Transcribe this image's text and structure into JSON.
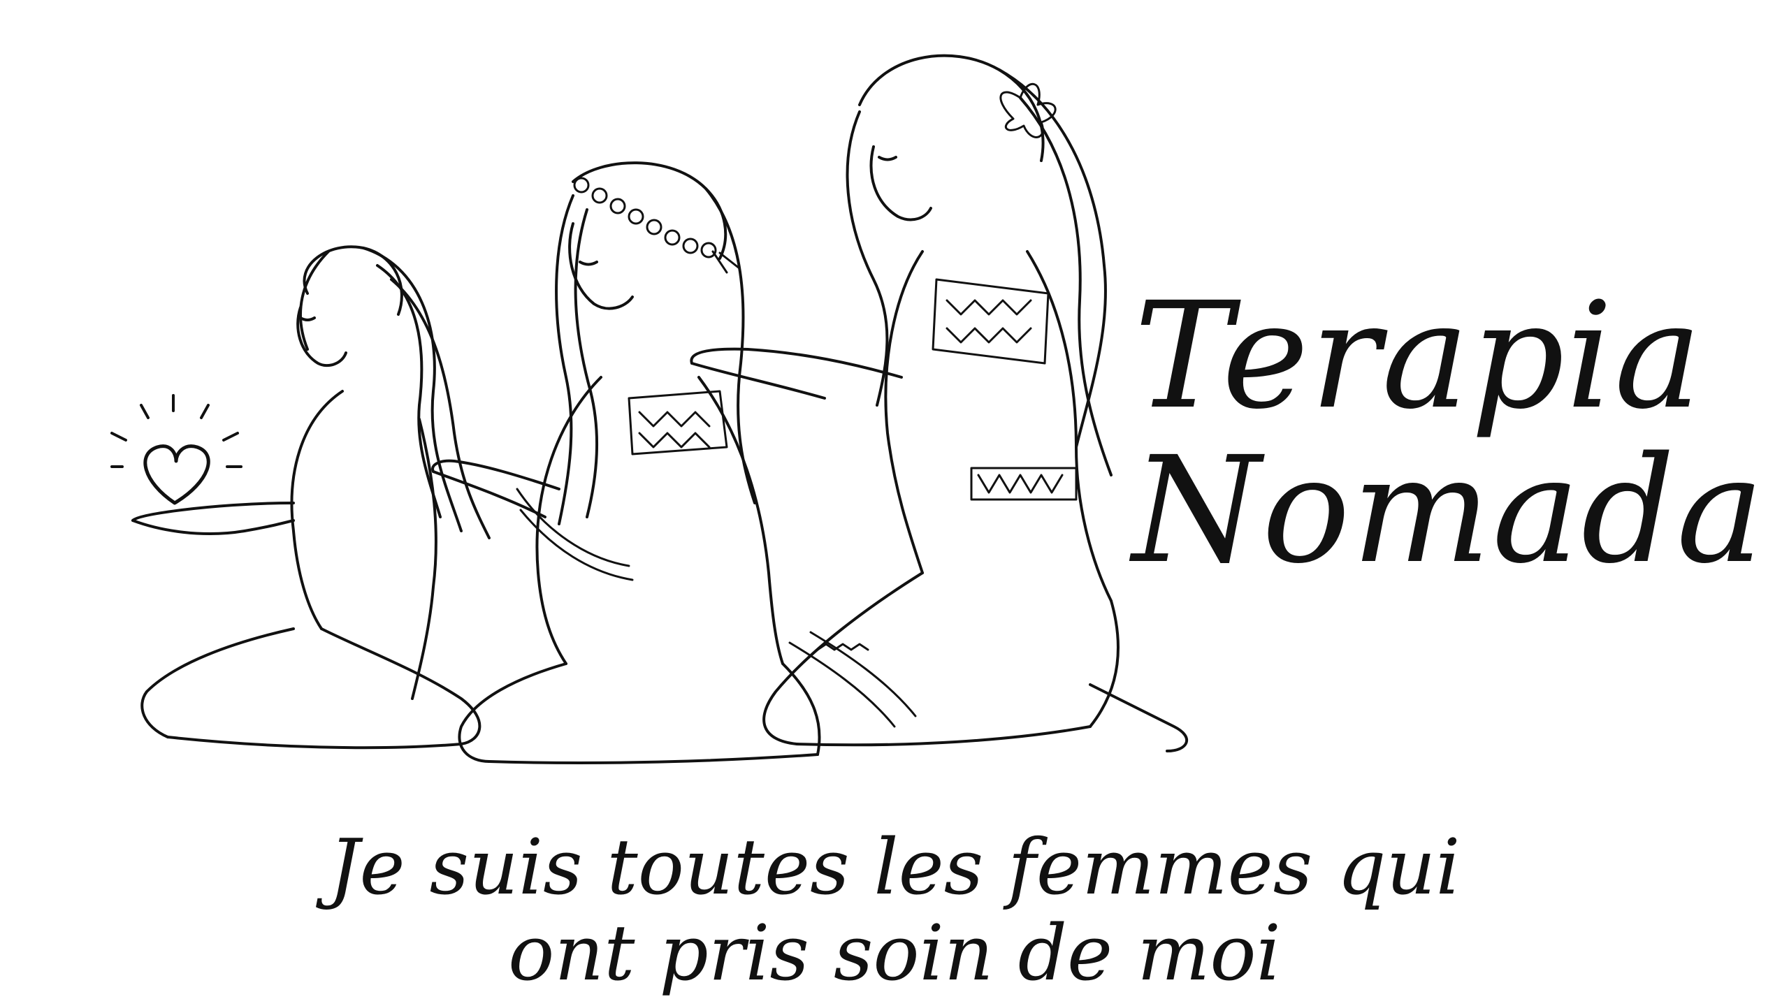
{
  "brand": {
    "line1": "Terapia",
    "line2": "Nomada"
  },
  "tagline": {
    "line1": "Je suis toutes les femmes qui",
    "line2": "ont pris soin de moi"
  },
  "colors": {
    "ink": "#111111",
    "background": "#ffffff"
  },
  "illustration": {
    "subject": "three kneeling women in embroidered blouses, one holding a glowing heart",
    "icon": "heart-icon"
  }
}
